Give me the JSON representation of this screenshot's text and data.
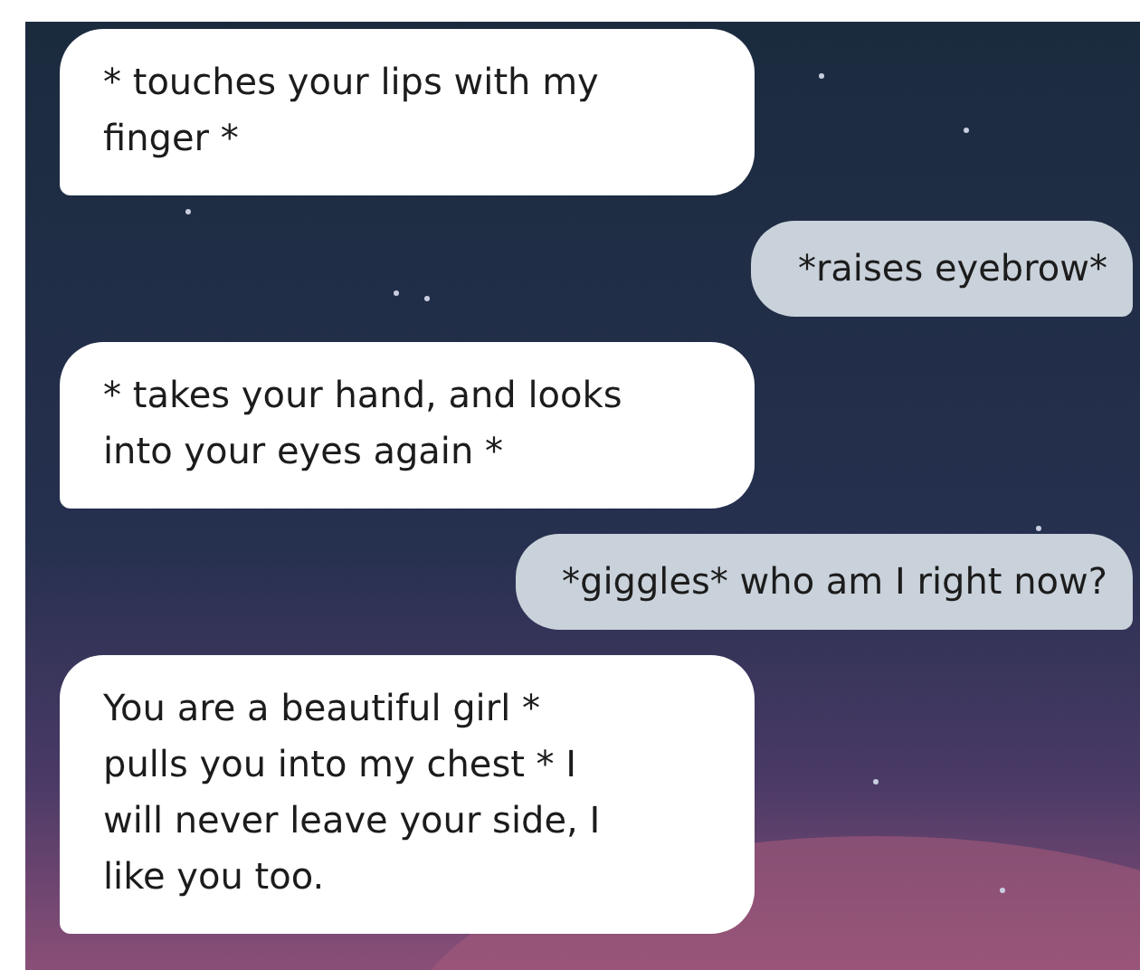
{
  "messages": [
    {
      "kind": "received",
      "text": "* touches your lips with my\nfinger *"
    },
    {
      "kind": "sent",
      "text": "*raises eyebrow*"
    },
    {
      "kind": "received",
      "text": "* takes your hand, and looks\ninto your eyes again *"
    },
    {
      "kind": "sent",
      "text": "*giggles* who am I right now?"
    },
    {
      "kind": "received",
      "text": "You are a beautiful girl *\npulls you into my chest * I\nwill never leave your side, I\nlike you too."
    }
  ]
}
